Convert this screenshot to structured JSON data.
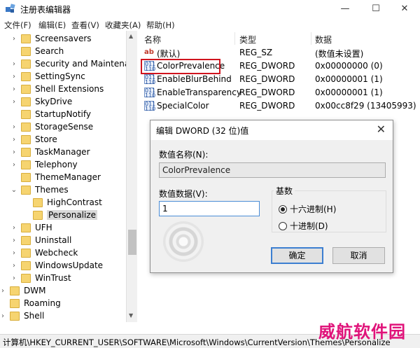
{
  "window": {
    "title": "注册表编辑器",
    "minimize": "—",
    "maximize": "☐",
    "close": "✕"
  },
  "menu": [
    "文件(F)",
    "编辑(E)",
    "查看(V)",
    "收藏夹(A)",
    "帮助(H)"
  ],
  "tree": [
    {
      "label": "Screensavers",
      "arrow": "›"
    },
    {
      "label": "Search",
      "arrow": ""
    },
    {
      "label": "Security and Maintenance",
      "arrow": "›"
    },
    {
      "label": "SettingSync",
      "arrow": "›"
    },
    {
      "label": "Shell Extensions",
      "arrow": "›"
    },
    {
      "label": "SkyDrive",
      "arrow": "›"
    },
    {
      "label": "StartupNotify",
      "arrow": ""
    },
    {
      "label": "StorageSense",
      "arrow": "›"
    },
    {
      "label": "Store",
      "arrow": "›"
    },
    {
      "label": "TaskManager",
      "arrow": "›"
    },
    {
      "label": "Telephony",
      "arrow": "›"
    },
    {
      "label": "ThemeManager",
      "arrow": ""
    },
    {
      "label": "Themes",
      "arrow": "⌄"
    },
    {
      "label": "HighContrast",
      "arrow": ""
    },
    {
      "label": "Personalize",
      "arrow": ""
    },
    {
      "label": "UFH",
      "arrow": "›"
    },
    {
      "label": "Uninstall",
      "arrow": "›"
    },
    {
      "label": "Webcheck",
      "arrow": "›"
    },
    {
      "label": "WindowsUpdate",
      "arrow": "›"
    },
    {
      "label": "WinTrust",
      "arrow": "›"
    },
    {
      "label": "DWM",
      "arrow": "›"
    },
    {
      "label": "Roaming",
      "arrow": ""
    },
    {
      "label": "Shell",
      "arrow": "›"
    }
  ],
  "columns": {
    "name": "名称",
    "type": "类型",
    "data": "数据"
  },
  "values": [
    {
      "icon": "ab",
      "name": "(默认)",
      "type": "REG_SZ",
      "data": "(数值未设置)"
    },
    {
      "icon": "dword",
      "name": "ColorPrevalence",
      "type": "REG_DWORD",
      "data": "0x00000000 (0)"
    },
    {
      "icon": "dword",
      "name": "EnableBlurBehind",
      "type": "REG_DWORD",
      "data": "0x00000001 (1)"
    },
    {
      "icon": "dword",
      "name": "EnableTransparency",
      "type": "REG_DWORD",
      "data": "0x00000001 (1)"
    },
    {
      "icon": "dword",
      "name": "SpecialColor",
      "type": "REG_DWORD",
      "data": "0x00cc8f29 (13405993)"
    }
  ],
  "dialog": {
    "title": "编辑 DWORD (32 位)值",
    "close": "✕",
    "name_label": "数值名称(N):",
    "name_value": "ColorPrevalence",
    "data_label": "数值数据(V):",
    "data_value": "1",
    "base_label": "基数",
    "hex_label": "十六进制(H)",
    "dec_label": "十进制(D)",
    "ok": "确定",
    "cancel": "取消"
  },
  "status": "计算机\\HKEY_CURRENT_USER\\SOFTWARE\\Microsoft\\Windows\\CurrentVersion\\Themes\\Personalize",
  "watermark": "威航软件园",
  "icon_glyph": {
    "ab": "ab",
    "dword": "011\n110"
  },
  "scroll": {
    "up": "▲",
    "down": "▼"
  }
}
